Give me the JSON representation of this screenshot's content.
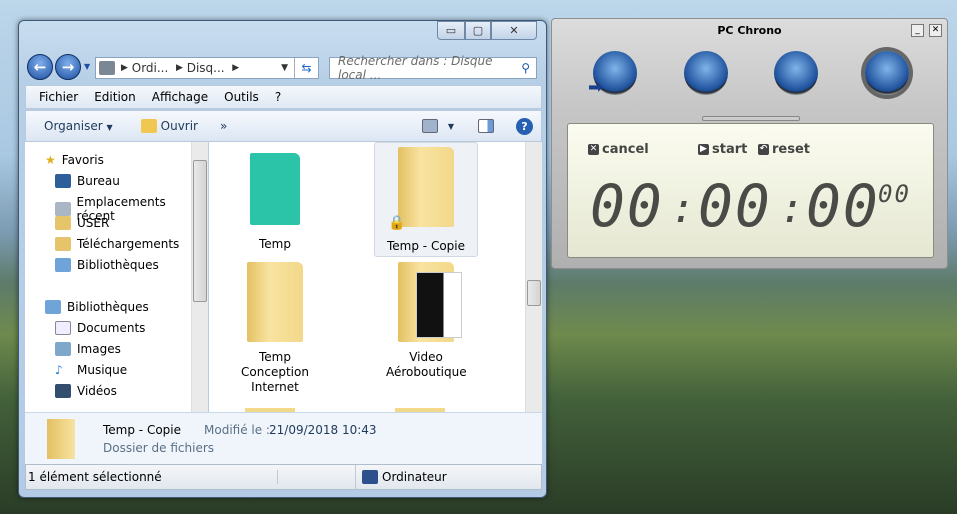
{
  "explorer": {
    "window_buttons": {
      "minimize": "▭",
      "maximize": "▢",
      "close": "✕"
    },
    "address": {
      "segments": [
        "Ordi...",
        "Disq..."
      ]
    },
    "search": {
      "placeholder": "Rechercher dans : Disque local ..."
    },
    "menu": [
      "Fichier",
      "Edition",
      "Affichage",
      "Outils",
      "?"
    ],
    "toolbar": {
      "organize": "Organiser",
      "open": "Ouvrir",
      "more": "»"
    },
    "nav": {
      "favorites_header": "Favoris",
      "favorites": [
        "Bureau",
        "Emplacements récent",
        "USER",
        "Téléchargements",
        "Bibliothèques"
      ],
      "libraries_header": "Bibliothèques",
      "libraries": [
        "Documents",
        "Images",
        "Musique",
        "Vidéos"
      ]
    },
    "items": [
      {
        "name": "Temp"
      },
      {
        "name": "Temp - Copie",
        "selected": true
      },
      {
        "name": "Temp Conception Internet"
      },
      {
        "name": "Video Aéroboutique"
      }
    ],
    "details": {
      "name": "Temp - Copie",
      "modified_label": "Modifié le :",
      "modified_value": "21/09/2018 10:43",
      "type": "Dossier de fichiers"
    },
    "status": {
      "selection": "1 élément sélectionné",
      "location": "Ordinateur"
    }
  },
  "chrono": {
    "title": "PC Chrono",
    "controls": {
      "cancel": "cancel",
      "start": "start",
      "reset": "reset"
    },
    "time": {
      "hours": "00",
      "minutes": "00",
      "seconds": "00",
      "hundredths": "00",
      "sep": ":"
    }
  },
  "colors": {
    "temp_folder": "#2cc4a8",
    "folder": "#f2d889",
    "lcd": "#f4f6e2"
  }
}
